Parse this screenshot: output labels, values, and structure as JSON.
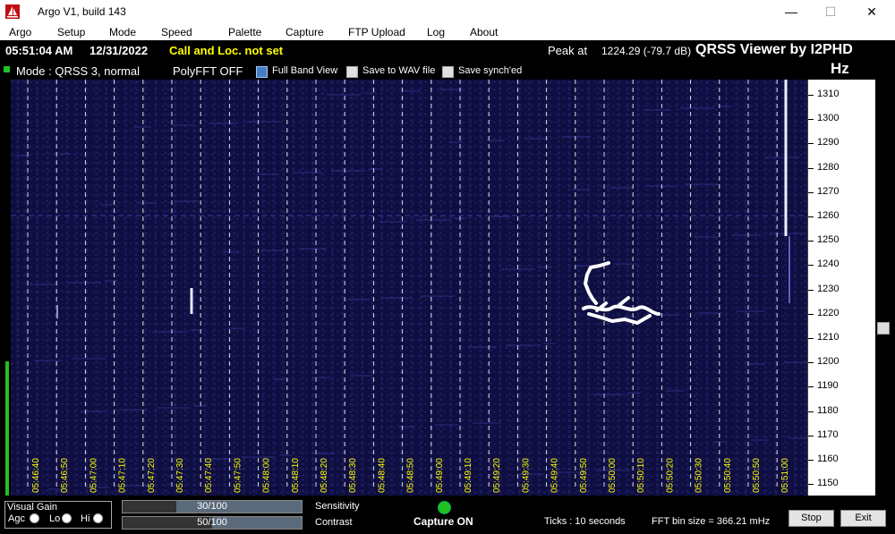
{
  "window": {
    "title": "Argo V1, build 143",
    "minimize": "—",
    "maximize": "☐",
    "close": "✕"
  },
  "menu": [
    "Argo",
    "Setup",
    "Mode",
    "Speed",
    "Palette",
    "Capture",
    "FTP Upload",
    "Log",
    "About"
  ],
  "status": {
    "time": "05:51:04 AM",
    "date": "12/31/2022",
    "callsign": "Call and Loc. not set",
    "peak_label": "Peak at",
    "peak_value": "1224.29 (-79.7 dB)",
    "app_name": "QRSS Viewer by I2PHD",
    "unit": "Hz",
    "mode": "Mode : QRSS 3, normal",
    "polyfft": "PolyFFT OFF",
    "full_band": "Full Band View",
    "save_wav": "Save to WAV file",
    "save_synched": "Save synch'ed"
  },
  "freq_scale": [
    "1310",
    "1300",
    "1290",
    "1280",
    "1270",
    "1260",
    "1250",
    "1240",
    "1230",
    "1220",
    "1210",
    "1200",
    "1190",
    "1180",
    "1170",
    "1160",
    "1150"
  ],
  "time_marks": [
    "05:46:40",
    "05:46:50",
    "05:47:00",
    "05:47:10",
    "05:47:20",
    "05:47:30",
    "05:47:40",
    "05:47:50",
    "05:48:00",
    "05:48:10",
    "05:48:20",
    "05:48:30",
    "05:48:40",
    "05:48:50",
    "05:49:00",
    "05:49:10",
    "05:49:20",
    "05:49:30",
    "05:49:40",
    "05:49:50",
    "05:50:00",
    "05:50:10",
    "05:50:20",
    "05:50:30",
    "05:50:40",
    "05:50:50",
    "05:51:00"
  ],
  "bottom": {
    "visual_gain": "Visual Gain",
    "agc": "Agc",
    "lo": "Lo",
    "hi": "Hi",
    "sensitivity_value": "30/100",
    "sensitivity_label": "Sensitivity",
    "contrast_value": "50/100",
    "contrast_label": "Contrast",
    "capture": "Capture ON",
    "ticks": "Ticks  : 10 seconds",
    "bin": "FFT bin size = 366.21 mHz",
    "stop": "Stop",
    "exit": "Exit"
  },
  "colors": {
    "yellow": "#ffff00",
    "waterfall_bg": "#0e0e40",
    "signal": "#ffffff",
    "capture_led": "#22c022"
  },
  "levels": {
    "sensitivity": 0.3,
    "contrast": 0.5
  }
}
